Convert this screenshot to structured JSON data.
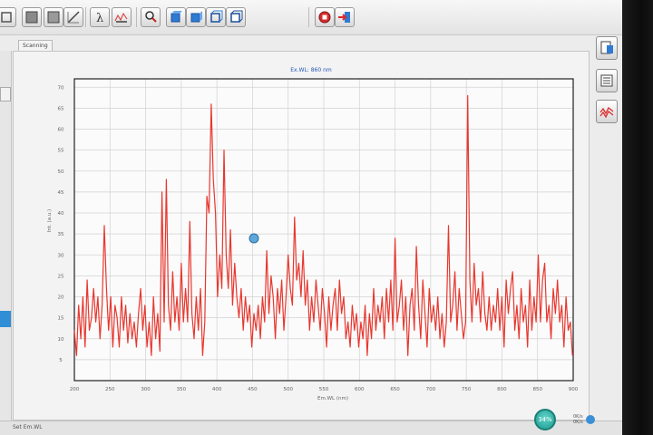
{
  "tab": {
    "label": "Scanning"
  },
  "status": {
    "text": "Set Em.WL",
    "cpu": "34%",
    "net_up": "0K/s",
    "net_down": "0K/s"
  },
  "toolbar": {
    "icons": [
      "fullscreen-icon",
      "panel-icon",
      "axis-icon",
      "lambda-icon",
      "scan-settings-icon",
      "search-icon",
      "cube-front-icon",
      "cube-top-icon",
      "cube-side-icon",
      "cube-3d-icon",
      "stop-icon",
      "export-icon"
    ]
  },
  "side": {
    "icons": [
      "report-icon",
      "list-icon",
      "spectrum-icon"
    ]
  },
  "colors": {
    "series": "#e8372e",
    "title": "#2456b5",
    "grid": "#d2d2d2"
  },
  "chart_data": {
    "type": "line",
    "title": "Ex.WL: 860 nm",
    "xlabel": "Em.WL (nm)",
    "ylabel": "Int. (a.u.)",
    "xlim": [
      200,
      900
    ],
    "ylim": [
      0,
      72
    ],
    "xticks": [
      200,
      250,
      300,
      350,
      400,
      450,
      500,
      550,
      600,
      650,
      700,
      750,
      800,
      850,
      900
    ],
    "yticks": [
      5,
      10,
      15,
      20,
      25,
      30,
      35,
      40,
      45,
      50,
      55,
      60,
      65,
      70
    ],
    "grid": true,
    "series": [
      {
        "values": [
          [
            200,
            12
          ],
          [
            203,
            6
          ],
          [
            206,
            18
          ],
          [
            209,
            10
          ],
          [
            212,
            20
          ],
          [
            215,
            8
          ],
          [
            218,
            24
          ],
          [
            221,
            12
          ],
          [
            224,
            15
          ],
          [
            227,
            22
          ],
          [
            230,
            14
          ],
          [
            233,
            20
          ],
          [
            236,
            10
          ],
          [
            239,
            18
          ],
          [
            242,
            37
          ],
          [
            245,
            22
          ],
          [
            248,
            12
          ],
          [
            251,
            20
          ],
          [
            254,
            8
          ],
          [
            257,
            18
          ],
          [
            260,
            15
          ],
          [
            263,
            8
          ],
          [
            266,
            20
          ],
          [
            269,
            12
          ],
          [
            272,
            18
          ],
          [
            275,
            9
          ],
          [
            278,
            16
          ],
          [
            281,
            10
          ],
          [
            284,
            14
          ],
          [
            287,
            8
          ],
          [
            290,
            16
          ],
          [
            293,
            22
          ],
          [
            296,
            12
          ],
          [
            299,
            18
          ],
          [
            302,
            8
          ],
          [
            305,
            14
          ],
          [
            308,
            6
          ],
          [
            311,
            20
          ],
          [
            314,
            10
          ],
          [
            317,
            16
          ],
          [
            320,
            7
          ],
          [
            323,
            45
          ],
          [
            326,
            14
          ],
          [
            329,
            48
          ],
          [
            332,
            18
          ],
          [
            335,
            12
          ],
          [
            338,
            26
          ],
          [
            341,
            14
          ],
          [
            344,
            20
          ],
          [
            347,
            12
          ],
          [
            350,
            28
          ],
          [
            353,
            14
          ],
          [
            356,
            22
          ],
          [
            359,
            14
          ],
          [
            362,
            38
          ],
          [
            365,
            16
          ],
          [
            368,
            10
          ],
          [
            371,
            20
          ],
          [
            374,
            12
          ],
          [
            377,
            22
          ],
          [
            380,
            6
          ],
          [
            383,
            14
          ],
          [
            386,
            44
          ],
          [
            389,
            40
          ],
          [
            392,
            66
          ],
          [
            395,
            48
          ],
          [
            398,
            40
          ],
          [
            401,
            20
          ],
          [
            404,
            30
          ],
          [
            407,
            22
          ],
          [
            410,
            55
          ],
          [
            413,
            30
          ],
          [
            416,
            22
          ],
          [
            419,
            36
          ],
          [
            422,
            18
          ],
          [
            425,
            28
          ],
          [
            428,
            20
          ],
          [
            431,
            15
          ],
          [
            434,
            22
          ],
          [
            437,
            12
          ],
          [
            440,
            20
          ],
          [
            443,
            14
          ],
          [
            446,
            18
          ],
          [
            449,
            8
          ],
          [
            452,
            16
          ],
          [
            455,
            12
          ],
          [
            458,
            18
          ],
          [
            461,
            10
          ],
          [
            464,
            20
          ],
          [
            467,
            14
          ],
          [
            470,
            31
          ],
          [
            473,
            16
          ],
          [
            476,
            25
          ],
          [
            479,
            20
          ],
          [
            482,
            10
          ],
          [
            485,
            22
          ],
          [
            488,
            16
          ],
          [
            491,
            24
          ],
          [
            494,
            12
          ],
          [
            497,
            20
          ],
          [
            500,
            30
          ],
          [
            503,
            22
          ],
          [
            506,
            18
          ],
          [
            509,
            39
          ],
          [
            512,
            24
          ],
          [
            515,
            28
          ],
          [
            518,
            20
          ],
          [
            521,
            31
          ],
          [
            524,
            18
          ],
          [
            527,
            24
          ],
          [
            530,
            12
          ],
          [
            533,
            20
          ],
          [
            536,
            14
          ],
          [
            539,
            24
          ],
          [
            542,
            18
          ],
          [
            545,
            12
          ],
          [
            548,
            22
          ],
          [
            551,
            16
          ],
          [
            554,
            8
          ],
          [
            557,
            20
          ],
          [
            560,
            12
          ],
          [
            563,
            18
          ],
          [
            566,
            22
          ],
          [
            569,
            12
          ],
          [
            572,
            24
          ],
          [
            575,
            16
          ],
          [
            578,
            20
          ],
          [
            581,
            10
          ],
          [
            584,
            14
          ],
          [
            587,
            8
          ],
          [
            590,
            18
          ],
          [
            593,
            12
          ],
          [
            596,
            16
          ],
          [
            599,
            8
          ],
          [
            602,
            14
          ],
          [
            605,
            10
          ],
          [
            608,
            18
          ],
          [
            611,
            6
          ],
          [
            614,
            16
          ],
          [
            617,
            10
          ],
          [
            620,
            22
          ],
          [
            623,
            12
          ],
          [
            626,
            18
          ],
          [
            629,
            14
          ],
          [
            632,
            20
          ],
          [
            635,
            10
          ],
          [
            638,
            22
          ],
          [
            641,
            14
          ],
          [
            644,
            24
          ],
          [
            647,
            12
          ],
          [
            650,
            34
          ],
          [
            653,
            14
          ],
          [
            656,
            18
          ],
          [
            659,
            24
          ],
          [
            662,
            12
          ],
          [
            665,
            20
          ],
          [
            668,
            6
          ],
          [
            671,
            18
          ],
          [
            674,
            22
          ],
          [
            677,
            12
          ],
          [
            680,
            32
          ],
          [
            683,
            18
          ],
          [
            686,
            10
          ],
          [
            689,
            24
          ],
          [
            692,
            16
          ],
          [
            695,
            8
          ],
          [
            698,
            22
          ],
          [
            701,
            14
          ],
          [
            704,
            18
          ],
          [
            707,
            12
          ],
          [
            710,
            20
          ],
          [
            713,
            10
          ],
          [
            716,
            16
          ],
          [
            719,
            8
          ],
          [
            722,
            14
          ],
          [
            725,
            37
          ],
          [
            728,
            14
          ],
          [
            731,
            18
          ],
          [
            734,
            26
          ],
          [
            737,
            12
          ],
          [
            740,
            22
          ],
          [
            743,
            16
          ],
          [
            746,
            10
          ],
          [
            749,
            14
          ],
          [
            752,
            68
          ],
          [
            755,
            24
          ],
          [
            758,
            14
          ],
          [
            761,
            28
          ],
          [
            764,
            18
          ],
          [
            767,
            22
          ],
          [
            770,
            14
          ],
          [
            773,
            26
          ],
          [
            776,
            16
          ],
          [
            779,
            12
          ],
          [
            782,
            20
          ],
          [
            785,
            12
          ],
          [
            788,
            18
          ],
          [
            791,
            14
          ],
          [
            794,
            22
          ],
          [
            797,
            12
          ],
          [
            800,
            20
          ],
          [
            803,
            8
          ],
          [
            806,
            24
          ],
          [
            809,
            16
          ],
          [
            812,
            22
          ],
          [
            815,
            26
          ],
          [
            818,
            12
          ],
          [
            821,
            18
          ],
          [
            824,
            10
          ],
          [
            827,
            22
          ],
          [
            830,
            14
          ],
          [
            833,
            18
          ],
          [
            836,
            8
          ],
          [
            839,
            24
          ],
          [
            842,
            12
          ],
          [
            845,
            20
          ],
          [
            848,
            14
          ],
          [
            851,
            30
          ],
          [
            854,
            14
          ],
          [
            857,
            24
          ],
          [
            860,
            28
          ],
          [
            863,
            14
          ],
          [
            866,
            18
          ],
          [
            869,
            10
          ],
          [
            872,
            22
          ],
          [
            875,
            16
          ],
          [
            878,
            24
          ],
          [
            881,
            14
          ],
          [
            884,
            18
          ],
          [
            887,
            8
          ],
          [
            890,
            20
          ],
          [
            893,
            12
          ],
          [
            896,
            14
          ],
          [
            899,
            6
          ]
        ]
      }
    ]
  }
}
